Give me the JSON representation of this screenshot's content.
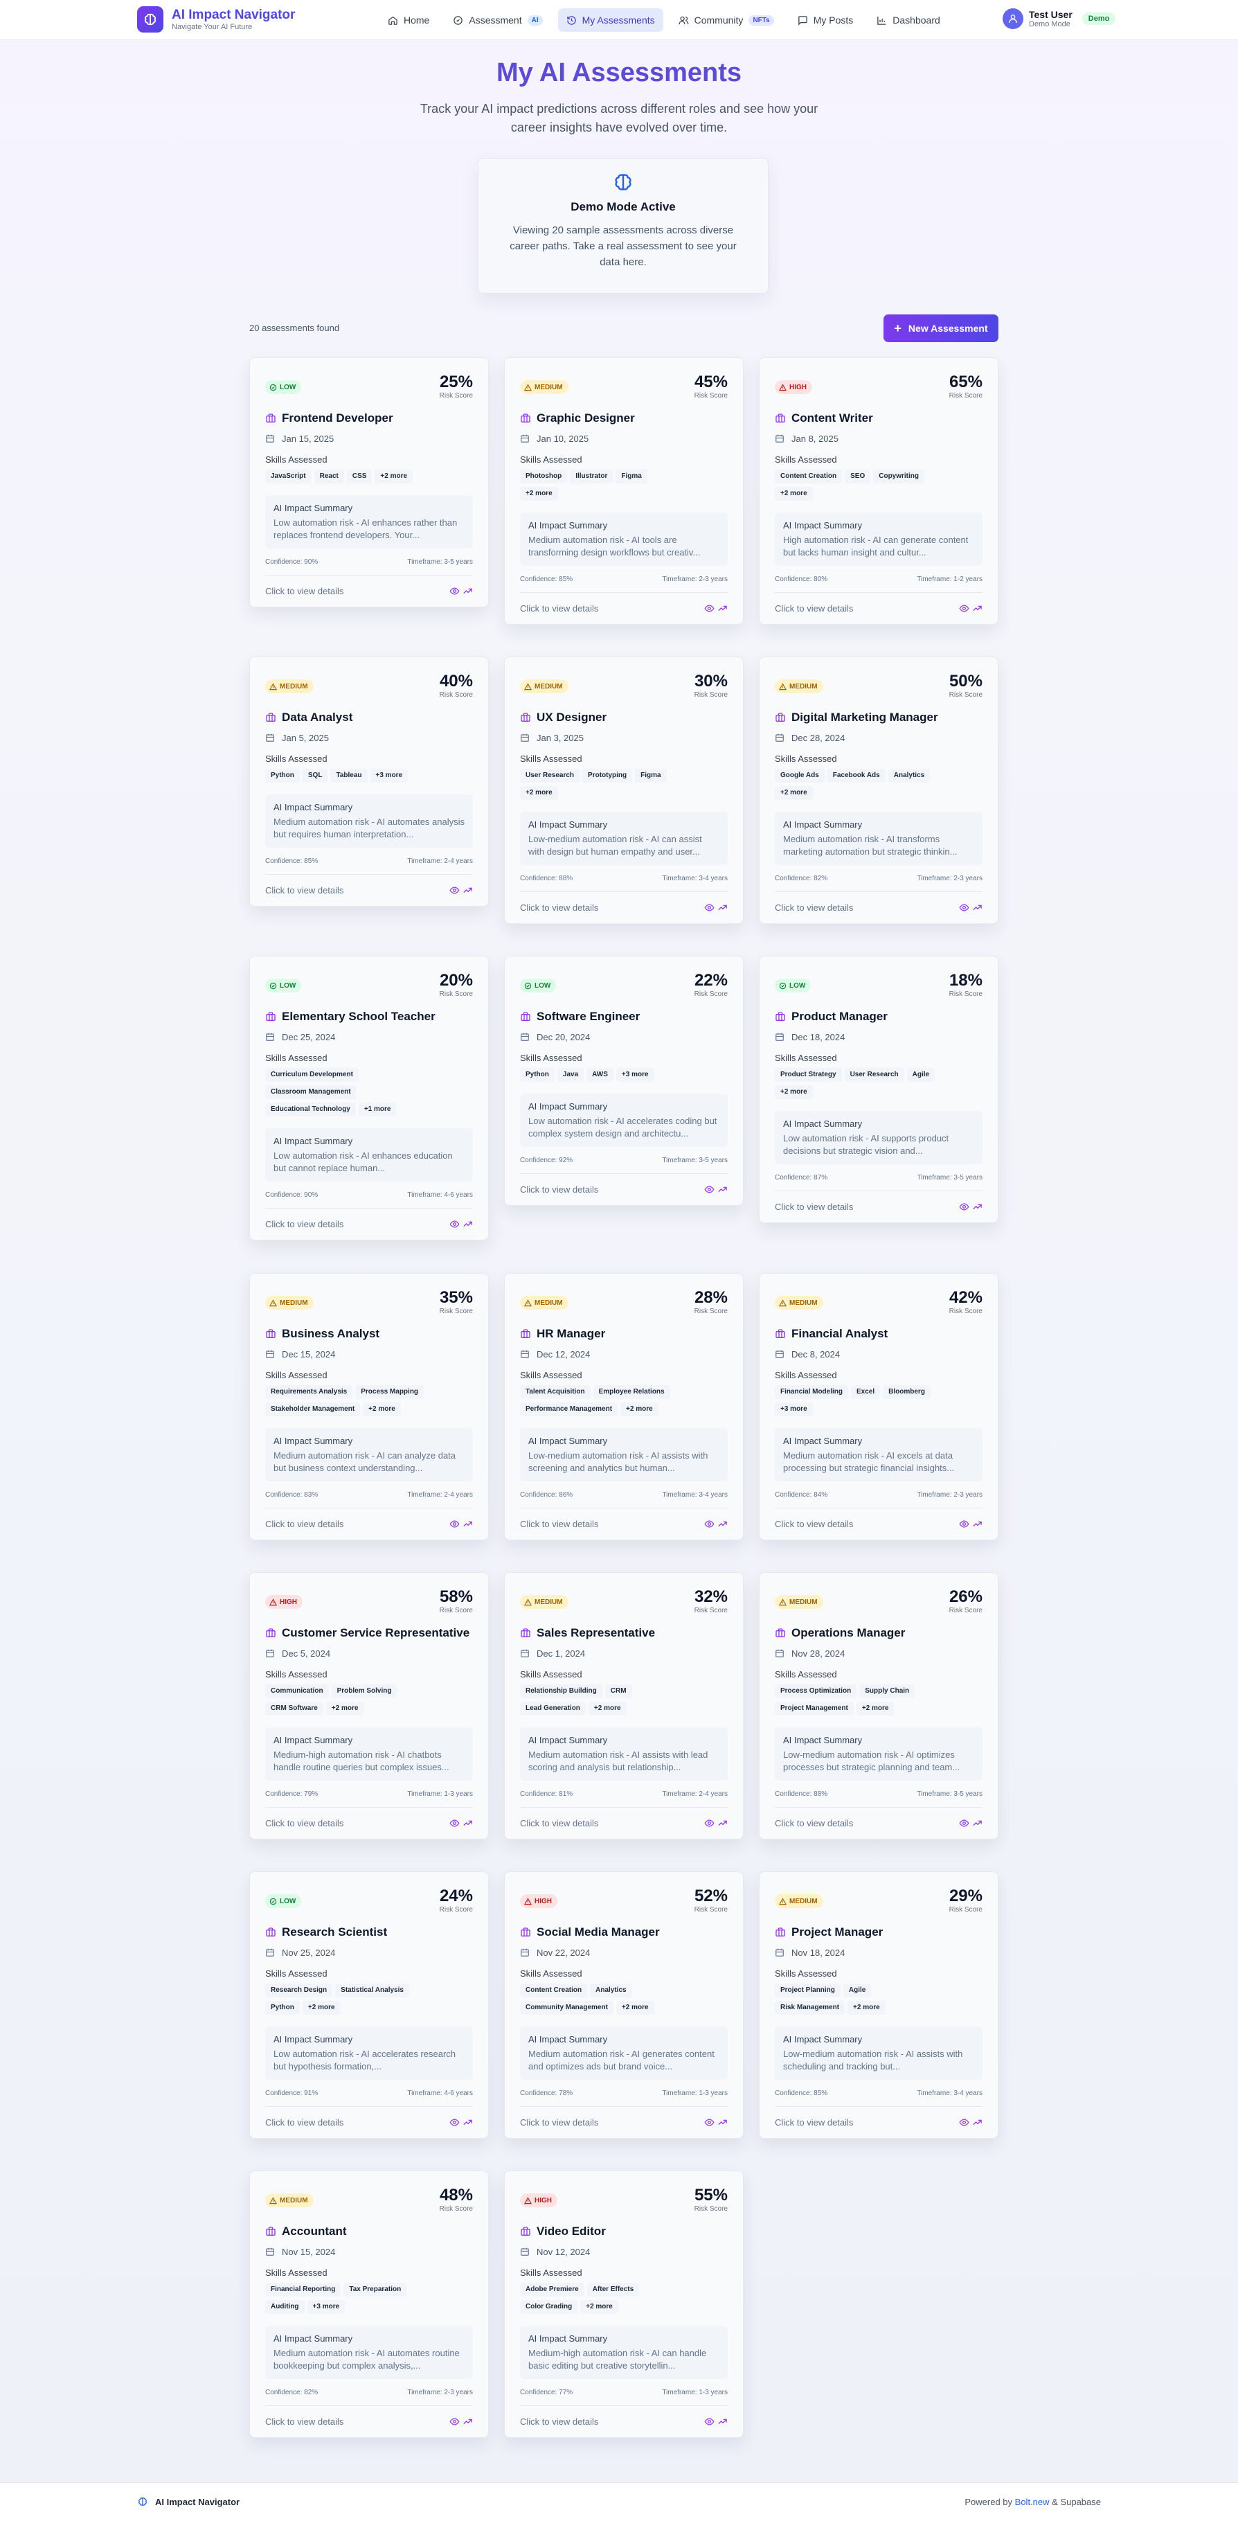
{
  "brand": {
    "title": "AI Impact Navigator",
    "subtitle": "Navigate Your AI Future"
  },
  "nav": [
    {
      "label": "Home",
      "icon": "home-icon"
    },
    {
      "label": "Assessment",
      "icon": "assessment-icon",
      "badge": "AI"
    },
    {
      "label": "My Assessments",
      "icon": "history-icon",
      "active": true
    },
    {
      "label": "Community",
      "icon": "users-icon",
      "badge": "NFTs"
    },
    {
      "label": "My Posts",
      "icon": "message-icon"
    },
    {
      "label": "Dashboard",
      "icon": "bar-chart-icon"
    }
  ],
  "user": {
    "name": "Test User",
    "role": "Demo Mode",
    "badge": "Demo"
  },
  "hero": {
    "title": "My AI Assessments",
    "subtitle": "Track your AI impact predictions across different roles and see how your career insights have evolved over time."
  },
  "demo": {
    "title": "Demo Mode Active",
    "text": "Viewing 20 sample assessments across diverse career paths. Take a real assessment to see your data here."
  },
  "toolbar": {
    "count": "20 assessments found",
    "new_button": "New Assessment"
  },
  "labels": {
    "risk_score": "Risk Score",
    "skills_assessed": "Skills Assessed",
    "ai_summary": "AI Impact Summary",
    "view": "Click to view details"
  },
  "colors": {
    "accent": "#5b4bd6",
    "low": "#15803d",
    "medium": "#a16207",
    "high": "#b91c1c"
  },
  "assessments": [
    {
      "risk": "low",
      "risk_label": "LOW",
      "score": "25%",
      "title": "Frontend Developer",
      "date": "Jan 15, 2025",
      "skills": [
        "JavaScript",
        "React",
        "CSS",
        "+2 more"
      ],
      "summary": "Low automation risk - AI enhances rather than replaces frontend developers. Your...",
      "confidence": "Confidence: 90%",
      "timeframe": "Timeframe: 3-5 years"
    },
    {
      "risk": "medium",
      "risk_label": "MEDIUM",
      "score": "45%",
      "title": "Graphic Designer",
      "date": "Jan 10, 2025",
      "skills": [
        "Photoshop",
        "Illustrator",
        "Figma",
        "+2 more"
      ],
      "summary": "Medium automation risk - AI tools are transforming design workflows but creativ...",
      "confidence": "Confidence: 85%",
      "timeframe": "Timeframe: 2-3 years"
    },
    {
      "risk": "high",
      "risk_label": "HIGH",
      "score": "65%",
      "title": "Content Writer",
      "date": "Jan 8, 2025",
      "skills": [
        "Content Creation",
        "SEO",
        "Copywriting",
        "+2 more"
      ],
      "summary": "High automation risk - AI can generate content but lacks human insight and cultur...",
      "confidence": "Confidence: 80%",
      "timeframe": "Timeframe: 1-2 years"
    },
    {
      "risk": "medium",
      "risk_label": "MEDIUM",
      "score": "40%",
      "title": "Data Analyst",
      "date": "Jan 5, 2025",
      "skills": [
        "Python",
        "SQL",
        "Tableau",
        "+3 more"
      ],
      "summary": "Medium automation risk - AI automates analysis but requires human interpretation...",
      "confidence": "Confidence: 85%",
      "timeframe": "Timeframe: 2-4 years"
    },
    {
      "risk": "medium",
      "risk_label": "MEDIUM",
      "score": "30%",
      "title": "UX Designer",
      "date": "Jan 3, 2025",
      "skills": [
        "User Research",
        "Prototyping",
        "Figma",
        "+2 more"
      ],
      "summary": "Low-medium automation risk - AI can assist with design but human empathy and user...",
      "confidence": "Confidence: 88%",
      "timeframe": "Timeframe: 3-4 years"
    },
    {
      "risk": "medium",
      "risk_label": "MEDIUM",
      "score": "50%",
      "title": "Digital Marketing Manager",
      "date": "Dec 28, 2024",
      "skills": [
        "Google Ads",
        "Facebook Ads",
        "Analytics",
        "+2 more"
      ],
      "summary": "Medium automation risk - AI transforms marketing automation but strategic thinkin...",
      "confidence": "Confidence: 82%",
      "timeframe": "Timeframe: 2-3 years"
    },
    {
      "risk": "low",
      "risk_label": "LOW",
      "score": "20%",
      "title": "Elementary School Teacher",
      "date": "Dec 25, 2024",
      "skills": [
        "Curriculum Development",
        "Classroom Management",
        "Educational Technology",
        "+1 more"
      ],
      "summary": "Low automation risk - AI enhances education but cannot replace human...",
      "confidence": "Confidence: 90%",
      "timeframe": "Timeframe: 4-6 years"
    },
    {
      "risk": "low",
      "risk_label": "LOW",
      "score": "22%",
      "title": "Software Engineer",
      "date": "Dec 20, 2024",
      "skills": [
        "Python",
        "Java",
        "AWS",
        "+3 more"
      ],
      "summary": "Low automation risk - AI accelerates coding but complex system design and architectu...",
      "confidence": "Confidence: 92%",
      "timeframe": "Timeframe: 3-5 years"
    },
    {
      "risk": "low",
      "risk_label": "LOW",
      "score": "18%",
      "title": "Product Manager",
      "date": "Dec 18, 2024",
      "skills": [
        "Product Strategy",
        "User Research",
        "Agile",
        "+2 more"
      ],
      "summary": "Low automation risk - AI supports product decisions but strategic vision and...",
      "confidence": "Confidence: 87%",
      "timeframe": "Timeframe: 3-5 years"
    },
    {
      "risk": "medium",
      "risk_label": "MEDIUM",
      "score": "35%",
      "title": "Business Analyst",
      "date": "Dec 15, 2024",
      "skills": [
        "Requirements Analysis",
        "Process Mapping",
        "Stakeholder Management",
        "+2 more"
      ],
      "summary": "Medium automation risk - AI can analyze data but business context understanding...",
      "confidence": "Confidence: 83%",
      "timeframe": "Timeframe: 2-4 years"
    },
    {
      "risk": "medium",
      "risk_label": "MEDIUM",
      "score": "28%",
      "title": "HR Manager",
      "date": "Dec 12, 2024",
      "skills": [
        "Talent Acquisition",
        "Employee Relations",
        "Performance Management",
        "+2 more"
      ],
      "summary": "Low-medium automation risk - AI assists with screening and analytics but human...",
      "confidence": "Confidence: 86%",
      "timeframe": "Timeframe: 3-4 years"
    },
    {
      "risk": "medium",
      "risk_label": "MEDIUM",
      "score": "42%",
      "title": "Financial Analyst",
      "date": "Dec 8, 2024",
      "skills": [
        "Financial Modeling",
        "Excel",
        "Bloomberg",
        "+3 more"
      ],
      "summary": "Medium automation risk - AI excels at data processing but strategic financial insights...",
      "confidence": "Confidence: 84%",
      "timeframe": "Timeframe: 2-3 years"
    },
    {
      "risk": "high",
      "risk_label": "HIGH",
      "score": "58%",
      "title": "Customer Service Representative",
      "date": "Dec 5, 2024",
      "skills": [
        "Communication",
        "Problem Solving",
        "CRM Software",
        "+2 more"
      ],
      "summary": "Medium-high automation risk - AI chatbots handle routine queries but complex issues...",
      "confidence": "Confidence: 79%",
      "timeframe": "Timeframe: 1-3 years"
    },
    {
      "risk": "medium",
      "risk_label": "MEDIUM",
      "score": "32%",
      "title": "Sales Representative",
      "date": "Dec 1, 2024",
      "skills": [
        "Relationship Building",
        "CRM",
        "Lead Generation",
        "+2 more"
      ],
      "summary": "Medium automation risk - AI assists with lead scoring and analysis but relationship...",
      "confidence": "Confidence: 81%",
      "timeframe": "Timeframe: 2-4 years"
    },
    {
      "risk": "medium",
      "risk_label": "MEDIUM",
      "score": "26%",
      "title": "Operations Manager",
      "date": "Nov 28, 2024",
      "skills": [
        "Process Optimization",
        "Supply Chain",
        "Project Management",
        "+2 more"
      ],
      "summary": "Low-medium automation risk - AI optimizes processes but strategic planning and team...",
      "confidence": "Confidence: 88%",
      "timeframe": "Timeframe: 3-5 years"
    },
    {
      "risk": "low",
      "risk_label": "LOW",
      "score": "24%",
      "title": "Research Scientist",
      "date": "Nov 25, 2024",
      "skills": [
        "Research Design",
        "Statistical Analysis",
        "Python",
        "+2 more"
      ],
      "summary": "Low automation risk - AI accelerates research but hypothesis formation,...",
      "confidence": "Confidence: 91%",
      "timeframe": "Timeframe: 4-6 years"
    },
    {
      "risk": "high",
      "risk_label": "HIGH",
      "score": "52%",
      "title": "Social Media Manager",
      "date": "Nov 22, 2024",
      "skills": [
        "Content Creation",
        "Analytics",
        "Community Management",
        "+2 more"
      ],
      "summary": "Medium automation risk - AI generates content and optimizes ads but brand voice...",
      "confidence": "Confidence: 78%",
      "timeframe": "Timeframe: 1-3 years"
    },
    {
      "risk": "medium",
      "risk_label": "MEDIUM",
      "score": "29%",
      "title": "Project Manager",
      "date": "Nov 18, 2024",
      "skills": [
        "Project Planning",
        "Agile",
        "Risk Management",
        "+2 more"
      ],
      "summary": "Low-medium automation risk - AI assists with scheduling and tracking but...",
      "confidence": "Confidence: 85%",
      "timeframe": "Timeframe: 3-4 years"
    },
    {
      "risk": "medium",
      "risk_label": "MEDIUM",
      "score": "48%",
      "title": "Accountant",
      "date": "Nov 15, 2024",
      "skills": [
        "Financial Reporting",
        "Tax Preparation",
        "Auditing",
        "+3 more"
      ],
      "summary": "Medium automation risk - AI automates routine bookkeeping but complex analysis,...",
      "confidence": "Confidence: 82%",
      "timeframe": "Timeframe: 2-3 years"
    },
    {
      "risk": "high",
      "risk_label": "HIGH",
      "score": "55%",
      "title": "Video Editor",
      "date": "Nov 12, 2024",
      "skills": [
        "Adobe Premiere",
        "After Effects",
        "Color Grading",
        "+2 more"
      ],
      "summary": "Medium-high automation risk - AI can handle basic editing but creative storytellin...",
      "confidence": "Confidence: 77%",
      "timeframe": "Timeframe: 1-3 years"
    }
  ],
  "footer": {
    "brand": "AI Impact Navigator",
    "powered": "Powered by",
    "link": "Bolt.new",
    "suffix": "& Supabase"
  }
}
